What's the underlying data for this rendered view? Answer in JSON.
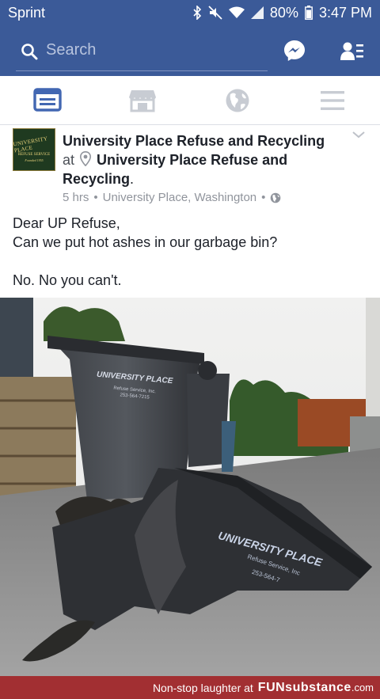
{
  "status_bar": {
    "carrier": "Sprint",
    "battery": "80%",
    "time": "3:47 PM"
  },
  "top_bar": {
    "search_placeholder": "Search",
    "search_icon": "search-icon",
    "messenger_icon": "messenger-icon",
    "friends_icon": "friend-requests-icon"
  },
  "nav_tabs": [
    {
      "name": "news-feed",
      "icon": "newsfeed-icon",
      "active": true
    },
    {
      "name": "marketplace",
      "icon": "shop-icon",
      "active": false
    },
    {
      "name": "notifications",
      "icon": "globe-icon",
      "active": false
    },
    {
      "name": "menu",
      "icon": "hamburger-icon",
      "active": false
    }
  ],
  "post": {
    "page_name": "University Place Refuse and Recycling",
    "at_text": "at",
    "location_name": "University Place Refuse and Recycling",
    "location_suffix": ".",
    "time": "5 hrs",
    "separator": "•",
    "place": "University Place, Washington",
    "audience_icon": "globe-icon",
    "logo_text": {
      "line1": "UNIVERSITY PLACE",
      "line2": "REFUSE SERVICE",
      "line3": "Founded 1955"
    },
    "text_lines": [
      "Dear UP Refuse,",
      "Can we put hot ashes in our garbage bin?",
      "",
      "No. No you can't."
    ],
    "bin_label": "UNIVERSITY PLACE",
    "bin_sub": "Refuse Service, Inc.",
    "bin_phone": "253-564-7215",
    "melted_label": "UNIVERSITY PLACE",
    "melted_sub": "Refuse Service, Inc",
    "melted_phone": "253-564-7"
  },
  "footer": {
    "prefix": "Non-stop laughter at",
    "brand": "FUNsubstance",
    "domain": ".com"
  },
  "colors": {
    "facebook_blue": "#3b5a98",
    "footer_red": "#a22f32",
    "meta_gray": "#90949c"
  }
}
